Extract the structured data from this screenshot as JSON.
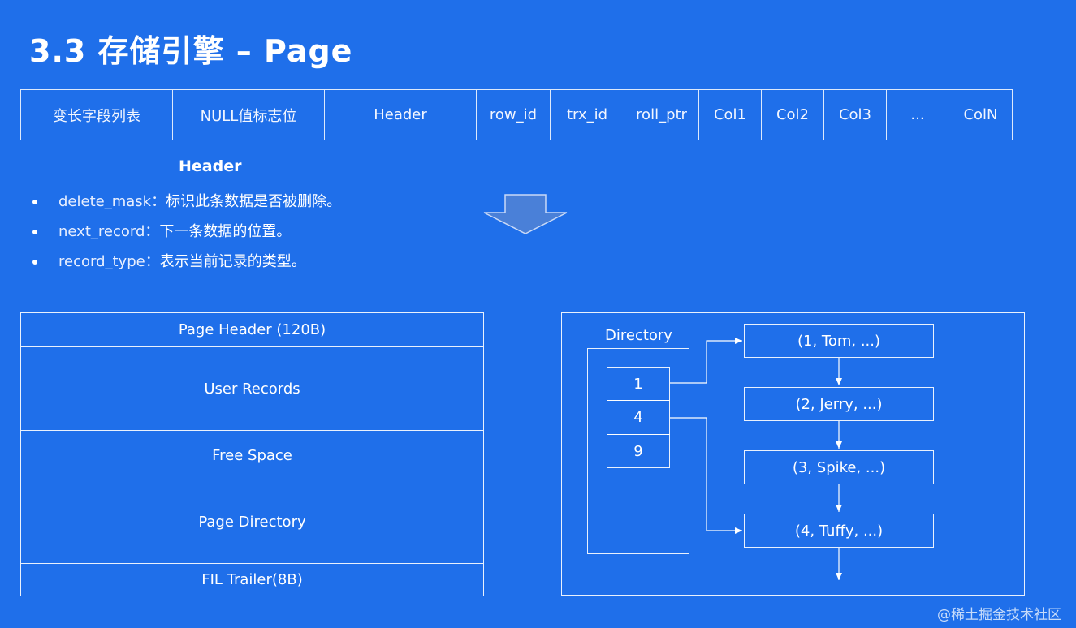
{
  "title": "3.3 存储引擎 – Page",
  "row_format": {
    "cells": [
      "变长字段列表",
      "NULL值标志位",
      "Header",
      "row_id",
      "trx_id",
      "roll_ptr",
      "Col1",
      "Col2",
      "Col3",
      "...",
      "ColN"
    ]
  },
  "header_section": {
    "title": "Header",
    "bullets": [
      {
        "key": "delete_mask：",
        "text": "标识此条数据是否被删除。"
      },
      {
        "key": "next_record：",
        "text": "下一条数据的位置。"
      },
      {
        "key": "record_type：",
        "text": "表示当前记录的类型。"
      }
    ]
  },
  "page_structure": {
    "segments": [
      "Page Header (120B)",
      "User Records",
      "Free Space",
      "Page Directory",
      "FIL Trailer(8B)"
    ]
  },
  "directory": {
    "label": "Directory",
    "slots": [
      "1",
      "4",
      "9"
    ],
    "records": [
      "(1, Tom, ...)",
      "(2, Jerry, ...)",
      "(3, Spike, ...)",
      "(4, Tuffy, ...)"
    ]
  },
  "watermark": "@稀土掘金技术社区",
  "colors": {
    "background": "#1f6fea",
    "arrow_fill": "#4a80d8"
  }
}
